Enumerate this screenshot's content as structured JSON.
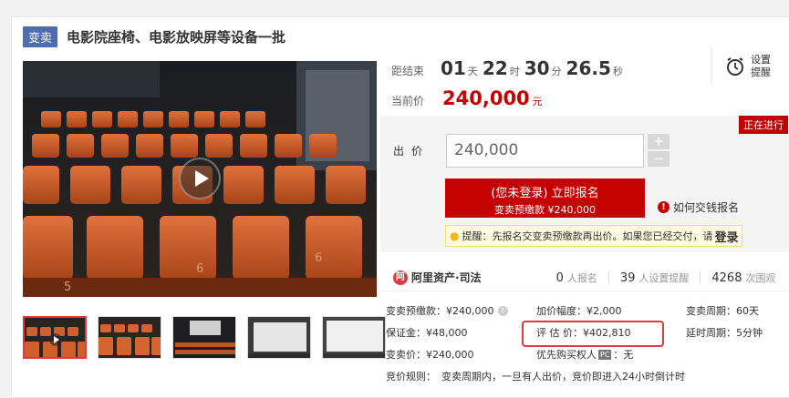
{
  "header": {
    "tag": "变卖",
    "title": "电影院座椅、电影放映屏等设备一批"
  },
  "media": {
    "play_icon": "play-icon",
    "thumbnail_count": 5
  },
  "countdown": {
    "label": "距结束",
    "days": "01",
    "days_unit": "天",
    "hours": "22",
    "hours_unit": "时",
    "minutes": "30",
    "minutes_unit": "分",
    "seconds": "26.5",
    "seconds_unit": "秒"
  },
  "reminder": {
    "icon": "alarm-clock-icon",
    "label": "设置提醒"
  },
  "current_price": {
    "label": "当前价",
    "value": "240,000",
    "unit": "元"
  },
  "status": "正在进行",
  "bid": {
    "label": "出价",
    "value": "240,000",
    "increment": "+",
    "decrement": "−"
  },
  "signup": {
    "line1": "(您未登录) 立即报名",
    "line2": "变卖预缴款 ¥240,000"
  },
  "howto": {
    "icon": "!",
    "label": "如何交钱报名"
  },
  "notice": {
    "text": "提醒：先报名交变卖预缴款再出价。如果您已经交付，请",
    "link": "登录"
  },
  "stats": {
    "logo_mark": "阿",
    "logo": "阿里资产·司法",
    "signups": "0",
    "signups_label": "人报名",
    "reminders": "39",
    "reminders_label": "人设置提醒",
    "views": "4268",
    "views_label": "次围观"
  },
  "details": {
    "deposit": "变卖预缴款：¥240,000",
    "increment": "加价幅度：¥2,000",
    "period": "变卖周期：60天",
    "guarantee": "保证金：¥48,000",
    "appraisal": "评 估 价：¥402,810",
    "delay": "延时周期：5分钟",
    "sale_price": "变卖价：¥240,000",
    "priority_prefix": "优先购买权人",
    "priority_tag": "PC",
    "priority_value": "：无",
    "rules_label": "竞价规则：",
    "rules": "变卖周期内，一旦有人出价，竞价即进入24小时倒计时"
  },
  "colors": {
    "accent": "#c40000",
    "tag_bg": "#4d6eae",
    "highlight": "#e4393c"
  }
}
